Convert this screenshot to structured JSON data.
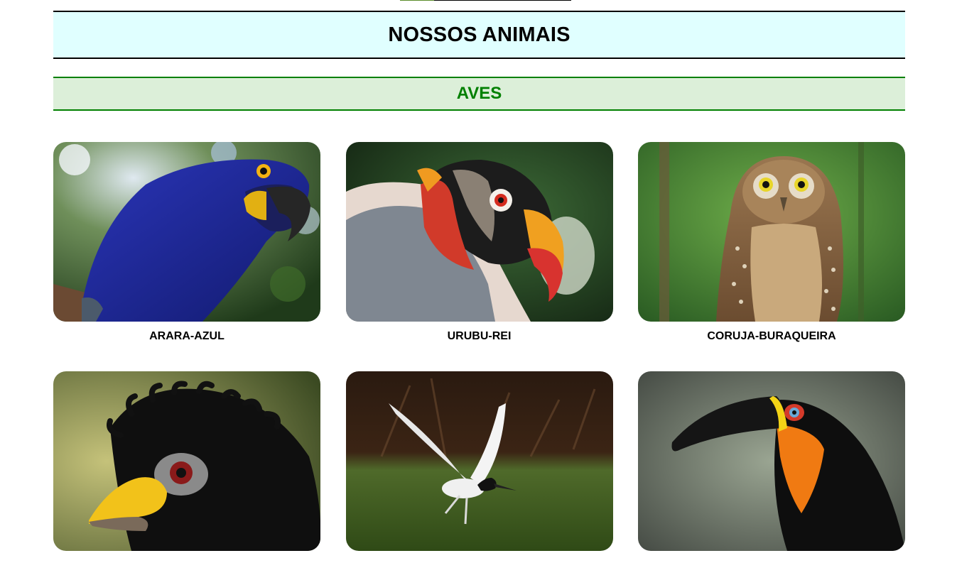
{
  "colors": {
    "header_bg": "#e0ffff",
    "section_bg": "#dcefd9",
    "section_accent": "#008000",
    "nav_accent": "#5a8c2a"
  },
  "header": {
    "title": "NOSSOS ANIMAIS"
  },
  "section": {
    "title": "AVES"
  },
  "animals": [
    {
      "name": "ARARA-AZUL",
      "icon": "hyacinth-macaw-photo"
    },
    {
      "name": "URUBU-REI",
      "icon": "king-vulture-photo"
    },
    {
      "name": "CORUJA-BURAQUEIRA",
      "icon": "burrowing-owl-photo"
    },
    {
      "name": "",
      "icon": "curassow-photo"
    },
    {
      "name": "",
      "icon": "jabiru-stork-photo"
    },
    {
      "name": "",
      "icon": "toucan-photo"
    }
  ]
}
